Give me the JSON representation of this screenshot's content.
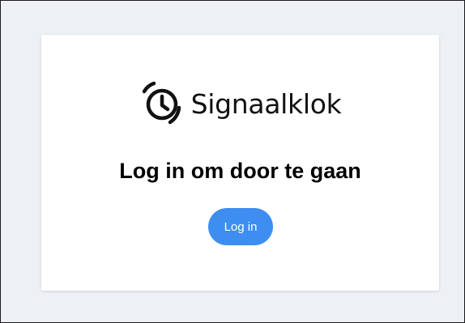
{
  "app": {
    "name": "Signaalklok",
    "logo_icon": "alarm-clock-icon"
  },
  "main": {
    "heading": "Log in om door te gaan",
    "login_button_label": "Log in"
  },
  "colors": {
    "page_background": "#edf0f5",
    "card_background": "#ffffff",
    "button_background": "#3d8ef0",
    "button_text": "#ffffff",
    "text": "#000000"
  }
}
